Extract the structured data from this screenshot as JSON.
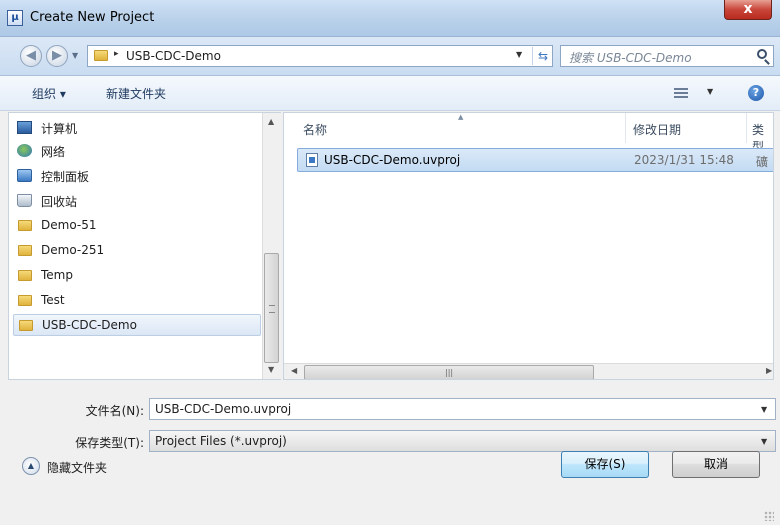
{
  "window": {
    "title": "Create New Project",
    "close_glyph": "x"
  },
  "address_bar": {
    "path_separator": "▸",
    "path": "USB-CDC-Demo",
    "search_placeholder": "搜索 USB-CDC-Demo"
  },
  "toolbar": {
    "organize_label": "组织 ▾",
    "new_folder_label": "新建文件夹",
    "help_glyph": "?"
  },
  "nav_pane": {
    "items": [
      {
        "label": "计算机",
        "icon": "computer-icon"
      },
      {
        "label": "网络",
        "icon": "network-icon"
      },
      {
        "label": "控制面板",
        "icon": "control-panel-icon"
      },
      {
        "label": "回收站",
        "icon": "recycle-bin-icon"
      },
      {
        "label": "Demo-51",
        "icon": "folder-icon"
      },
      {
        "label": "Demo-251",
        "icon": "folder-icon"
      },
      {
        "label": "Temp",
        "icon": "folder-icon"
      },
      {
        "label": "Test",
        "icon": "folder-icon"
      },
      {
        "label": "USB-CDC-Demo",
        "icon": "folder-icon",
        "selected": true
      }
    ]
  },
  "file_list": {
    "columns": {
      "name": "名称",
      "modified": "修改日期",
      "type": "类型"
    },
    "files": [
      {
        "name": "USB-CDC-Demo.uvproj",
        "modified": "2023/1/31 15:48",
        "type": "礦"
      }
    ]
  },
  "form": {
    "filename_label": "文件名(N):",
    "filename_value": "USB-CDC-Demo.uvproj",
    "filetype_label": "保存类型(T):",
    "filetype_value": "Project Files (*.uvproj)"
  },
  "footer": {
    "hide_folders_label": "隐藏文件夹",
    "save_label": "保存(S)",
    "cancel_label": "取消"
  },
  "colors": {
    "titlebar": "#b9d1ea",
    "selection": "#c3dbf3",
    "close_button": "#c9463a"
  }
}
